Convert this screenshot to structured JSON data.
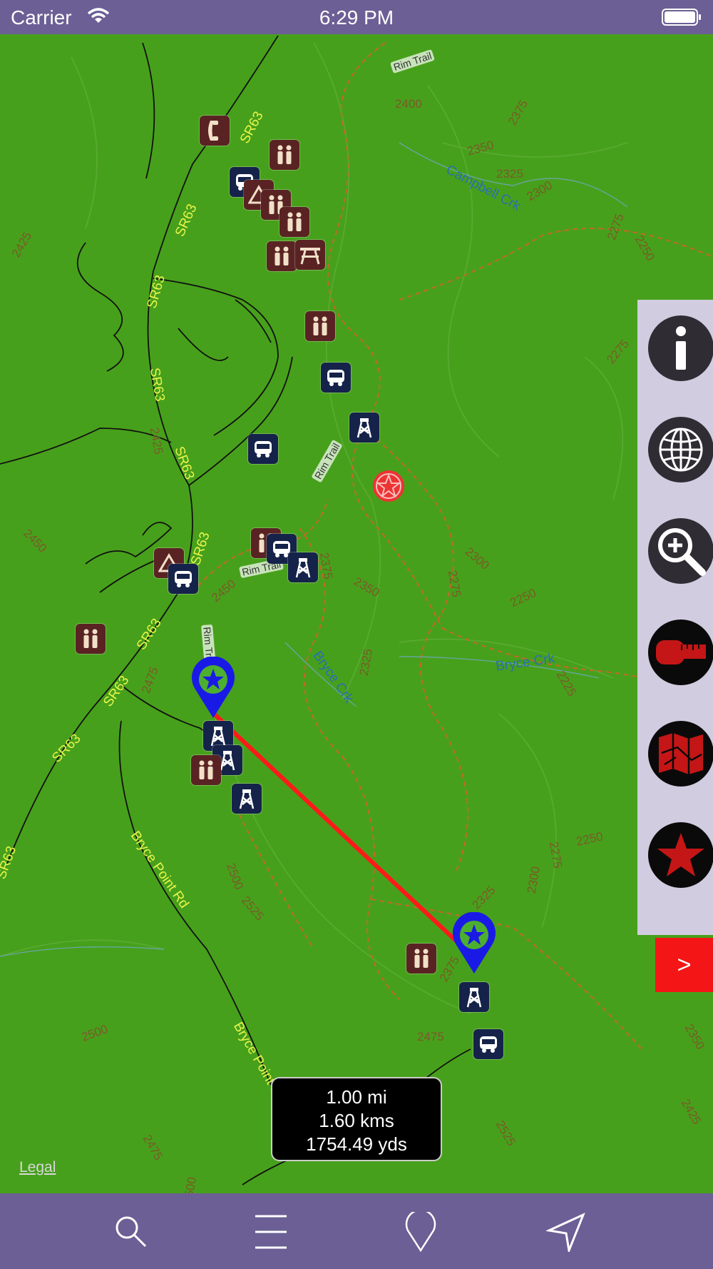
{
  "status_bar": {
    "carrier": "Carrier",
    "time": "6:29 PM"
  },
  "map": {
    "road_labels": [
      "SR63",
      "SR63",
      "SR63",
      "SR63",
      "SR63",
      "SR63",
      "SR63",
      "SR63",
      "SR63",
      "SR63",
      "Bryce Point Rd",
      "Bryce Point Rd"
    ],
    "water_labels": [
      "Campbell Crk",
      "Bryce Crk",
      "Bryce Crk"
    ],
    "trail_labels": [
      "Rim Trail",
      "Rim Trail",
      "Rim Trail",
      "Rim Trail"
    ],
    "contour_labels": [
      "2400",
      "2375",
      "2350",
      "2325",
      "2300",
      "2275",
      "2250",
      "2425",
      "2275",
      "2300",
      "2250",
      "2350",
      "2325",
      "2275",
      "2225",
      "2425",
      "2450",
      "2475",
      "2500",
      "2525",
      "2250",
      "2300",
      "2275",
      "2325",
      "2375",
      "2475",
      "2500",
      "2350",
      "2425",
      "2475",
      "2500",
      "2525",
      "2450",
      "2375"
    ],
    "icon_names": [
      "telephone-icon",
      "restroom-icon",
      "bus-icon",
      "campground-icon",
      "picnic-table-icon",
      "tower-icon",
      "star-icon"
    ]
  },
  "toolbar": {
    "icon_names": [
      "info-icon",
      "globe-icon",
      "zoom-in-icon",
      "measure-tape-icon",
      "map-icon",
      "favorites-star-icon"
    ],
    "expand_label": ">"
  },
  "measurement": {
    "miles": "1.00 mi",
    "kms": "1.60 kms",
    "yards": "1754.49 yds"
  },
  "legal_link": "Legal",
  "tab_bar": {
    "icon_names": [
      "search-icon",
      "menu-icon",
      "location-pin-icon",
      "navigate-icon"
    ]
  },
  "colors": {
    "bar": "#6b5f95",
    "map_green": "#47a01b",
    "measure_line": "#ff1a1a",
    "pin_blue": "#1a1ae6",
    "expand_button": "#f41616"
  }
}
